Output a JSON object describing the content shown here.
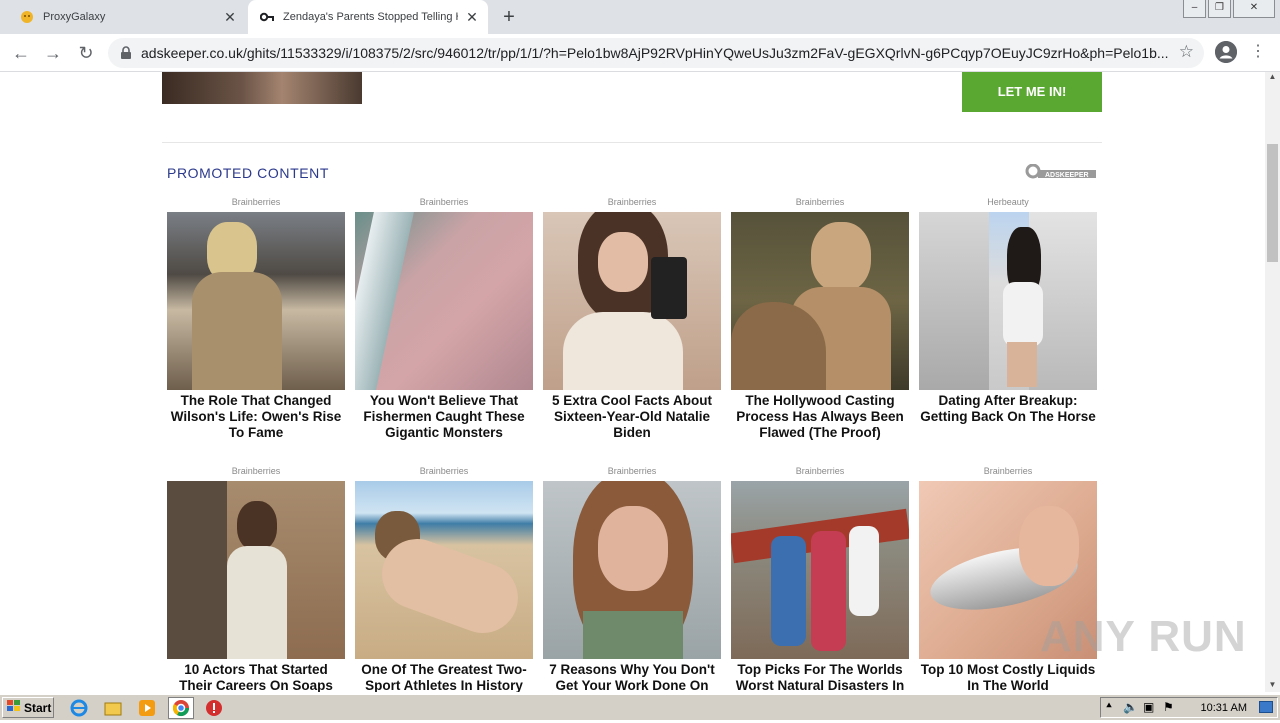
{
  "browser": {
    "tabs": [
      {
        "title": "ProxyGalaxy",
        "favicon": "proxygalaxy-favicon"
      },
      {
        "title": "Zendaya's Parents Stopped Telling H",
        "favicon": "key-icon",
        "active": true
      }
    ],
    "new_tab_symbol": "+",
    "url": "adskeeper.co.uk/ghits/11533329/i/108375/2/src/946012/tr/pp/1/1/?h=Pelo1bw8AjP92RVpHinYQweUsJu3zm2FaV-gEGXQrlvN-g6PCqyp7OEuyJC9zrHo&ph=Pelo1b..."
  },
  "page": {
    "cta_label": "LET ME IN!",
    "section_title": "PROMOTED CONTENT",
    "brand_logo_text": "ADSKEEPER",
    "watermark": "ANY RUN",
    "cards": [
      {
        "source": "Brainberries",
        "title": "The Role That Changed Wilson's Life: Owen's Rise To Fame"
      },
      {
        "source": "Brainberries",
        "title": "You Won't Believe That Fishermen Caught These Gigantic Monsters"
      },
      {
        "source": "Brainberries",
        "title": "5 Extra Cool Facts About Sixteen-Year-Old Natalie Biden"
      },
      {
        "source": "Brainberries",
        "title": "The Hollywood Casting Process Has Always Been Flawed (The Proof)"
      },
      {
        "source": "Herbeauty",
        "title": "Dating After Breakup: Getting Back On The Horse"
      },
      {
        "source": "Brainberries",
        "title": "10 Actors That Started Their Careers On Soaps"
      },
      {
        "source": "Brainberries",
        "title": "One Of The Greatest Two-Sport Athletes In History"
      },
      {
        "source": "Brainberries",
        "title": "7 Reasons Why You Don't Get Your Work Done On"
      },
      {
        "source": "Brainberries",
        "title": "Top Picks For The Worlds Worst Natural Disasters In"
      },
      {
        "source": "Brainberries",
        "title": "Top 10 Most Costly Liquids In The World"
      }
    ]
  },
  "taskbar": {
    "start_label": "Start",
    "clock": "10:31 AM"
  }
}
